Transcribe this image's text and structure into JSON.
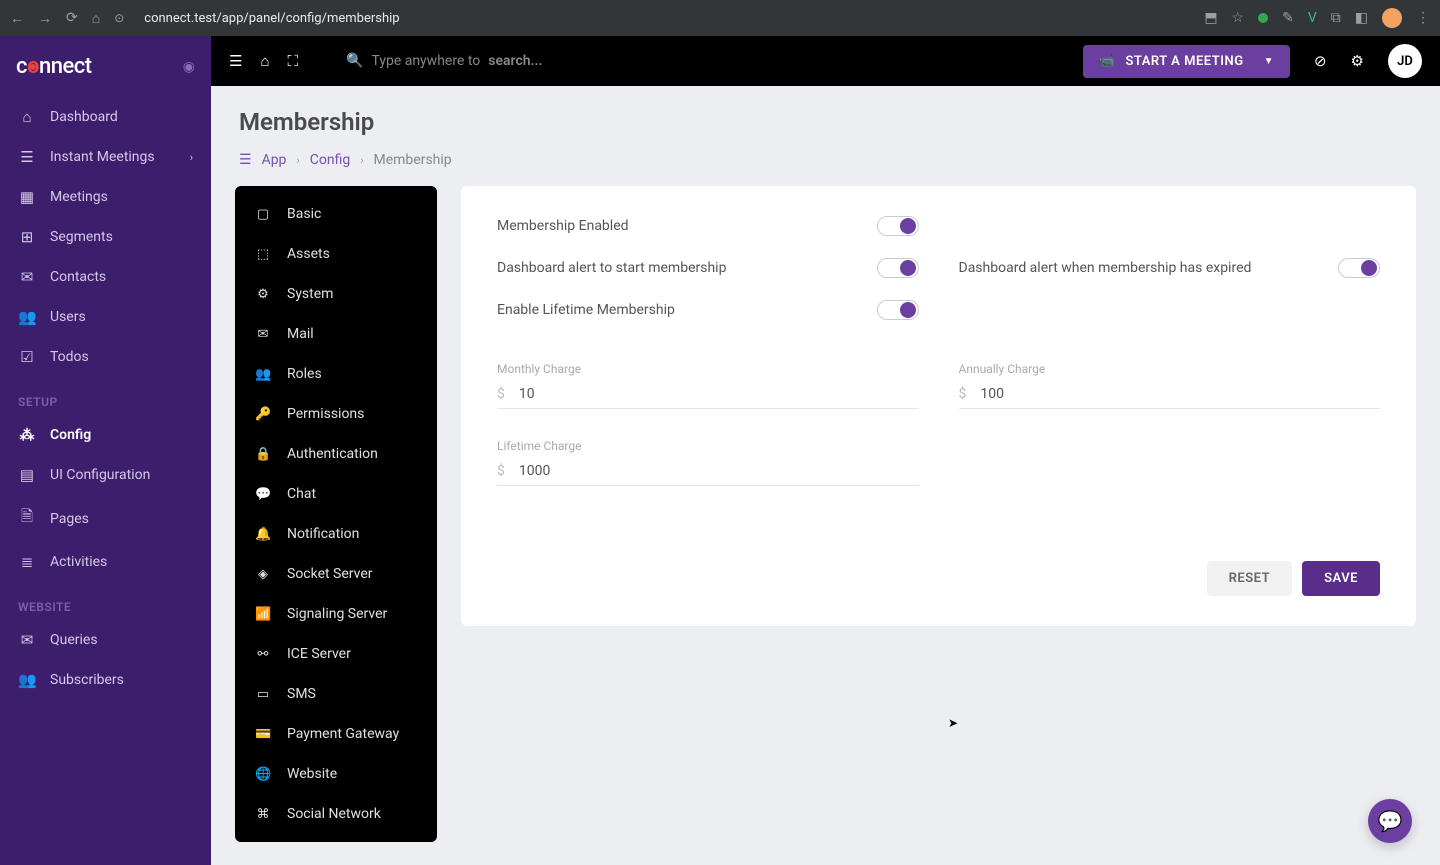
{
  "browser": {
    "url": "connect.test/app/panel/config/membership"
  },
  "logo": "connect",
  "sidebar": {
    "items": [
      {
        "icon": "⌂",
        "label": "Dashboard"
      },
      {
        "icon": "≡",
        "label": "Instant Meetings",
        "expandable": true
      },
      {
        "icon": "▦",
        "label": "Meetings"
      },
      {
        "icon": "⊞",
        "label": "Segments"
      },
      {
        "icon": "✉",
        "label": "Contacts"
      },
      {
        "icon": "👥",
        "label": "Users"
      },
      {
        "icon": "☑",
        "label": "Todos"
      }
    ],
    "setup_label": "SETUP",
    "setup_items": [
      {
        "icon": "⚙",
        "label": "Config",
        "active": true
      },
      {
        "icon": "▤",
        "label": "UI Configuration"
      },
      {
        "icon": "🗎",
        "label": "Pages"
      },
      {
        "icon": "≣",
        "label": "Activities"
      }
    ],
    "website_label": "WEBSITE",
    "website_items": [
      {
        "icon": "✉",
        "label": "Queries"
      },
      {
        "icon": "👥",
        "label": "Subscribers"
      }
    ]
  },
  "topbar": {
    "search_prefix": "Type anywhere to ",
    "search_bold": "search...",
    "meeting_btn": "START A MEETING",
    "avatar": "JD"
  },
  "page": {
    "title": "Membership",
    "breadcrumb": [
      "App",
      "Config",
      "Membership"
    ]
  },
  "config_nav": [
    {
      "icon": "▢",
      "label": "Basic"
    },
    {
      "icon": "⬚",
      "label": "Assets"
    },
    {
      "icon": "⚙",
      "label": "System"
    },
    {
      "icon": "✉",
      "label": "Mail"
    },
    {
      "icon": "👥",
      "label": "Roles"
    },
    {
      "icon": "🔑",
      "label": "Permissions"
    },
    {
      "icon": "🔒",
      "label": "Authentication"
    },
    {
      "icon": "💬",
      "label": "Chat"
    },
    {
      "icon": "🔔",
      "label": "Notification"
    },
    {
      "icon": "◈",
      "label": "Socket Server"
    },
    {
      "icon": "📶",
      "label": "Signaling Server"
    },
    {
      "icon": "⚯",
      "label": "ICE Server"
    },
    {
      "icon": "▭",
      "label": "SMS"
    },
    {
      "icon": "💳",
      "label": "Payment Gateway"
    },
    {
      "icon": "🌐",
      "label": "Website"
    },
    {
      "icon": "⌘",
      "label": "Social Network"
    }
  ],
  "form": {
    "membership_enabled": {
      "label": "Membership Enabled",
      "value": true
    },
    "alert_start": {
      "label": "Dashboard alert to start membership",
      "value": true
    },
    "alert_expired": {
      "label": "Dashboard alert when membership has expired",
      "value": true
    },
    "lifetime_enabled": {
      "label": "Enable Lifetime Membership",
      "value": true
    },
    "monthly": {
      "label": "Monthly Charge",
      "prefix": "$",
      "value": "10"
    },
    "annually": {
      "label": "Annually Charge",
      "prefix": "$",
      "value": "100"
    },
    "lifetime": {
      "label": "Lifetime Charge",
      "prefix": "$",
      "value": "1000"
    },
    "reset": "RESET",
    "save": "SAVE"
  }
}
